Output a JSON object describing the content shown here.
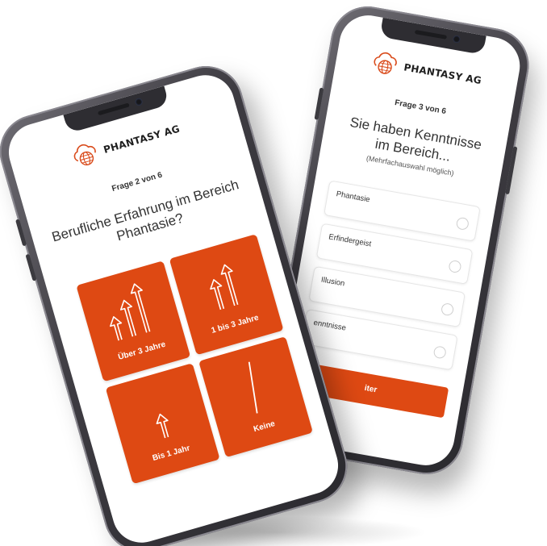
{
  "front_phone": {
    "brand": "PHANTASY AG",
    "counter": "Frage 2 von 6",
    "question": "Berufliche Erfahrung im Bereich Phantasie?",
    "tiles": [
      {
        "label": "Über 3 Jahre",
        "icon": "three-arrows-up-icon"
      },
      {
        "label": "1 bis 3 Jahre",
        "icon": "two-arrows-up-icon"
      },
      {
        "label": "Bis 1 Jahr",
        "icon": "one-arrow-up-icon"
      },
      {
        "label": "Keine",
        "icon": "slash-line-icon"
      }
    ]
  },
  "back_phone": {
    "brand": "PHANTASY AG",
    "counter": "Frage 3 von 6",
    "question": "Sie haben Kenntnisse im Bereich...",
    "hint": "(Mehrfachauswahl möglich)",
    "options": [
      {
        "label": "Phantasie"
      },
      {
        "label": "Erfindergeist"
      },
      {
        "label": "Illusion"
      },
      {
        "label": "enntnisse"
      }
    ],
    "button_label": "iter"
  },
  "colors": {
    "accent": "#de4913",
    "phone_frame": "#3d3b41",
    "screen": "#ffffff"
  }
}
